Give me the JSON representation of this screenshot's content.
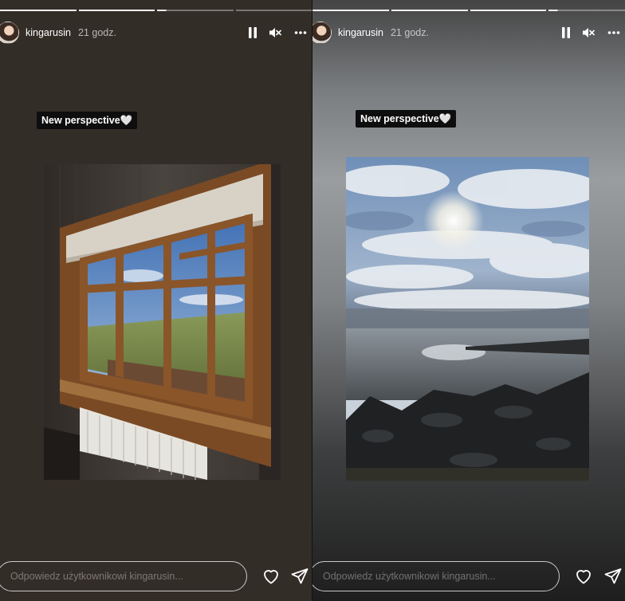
{
  "stories": [
    {
      "id": "left",
      "username": "kingarusin",
      "time": "21 godz.",
      "sticker": "New perspective",
      "sticker_emoji": "🤍",
      "photo_subject": "window-interior",
      "reply_placeholder": "Odpowiedz użytkownikowi kingarusin...",
      "progress": [
        "done",
        "done",
        "partial",
        "empty"
      ]
    },
    {
      "id": "right",
      "username": "kingarusin",
      "time": "21 godz.",
      "sticker": "New perspective",
      "sticker_emoji": "🤍",
      "photo_subject": "coastline-sky",
      "reply_placeholder": "Odpowiedz użytkownikowi kingarusin...",
      "progress": [
        "done",
        "done",
        "done",
        "partial"
      ]
    }
  ],
  "icons": {
    "pause": "pause-icon",
    "mute": "speaker-muted-icon",
    "more": "more-horizontal-icon",
    "like": "heart-outline-icon",
    "share": "paper-plane-icon"
  },
  "colors": {
    "left_background": "#332d27",
    "text": "#ffffff",
    "sticker_background": "#0e0e0e"
  }
}
